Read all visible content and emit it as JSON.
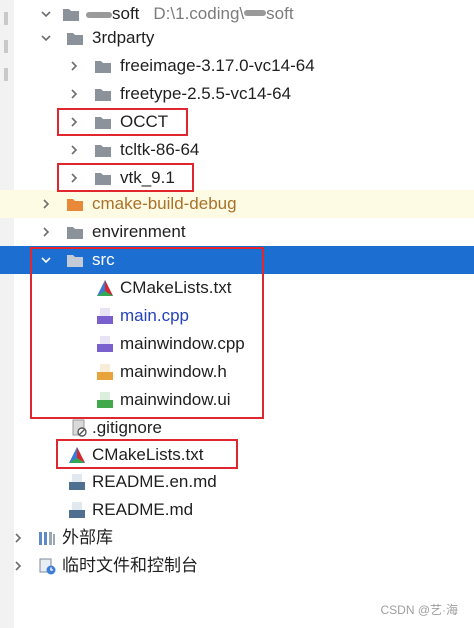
{
  "tree": {
    "root": {
      "label": "soft",
      "path": "D:\\1.coding\\",
      "path_tail": "soft"
    },
    "thirdparty": {
      "label": "3rdparty"
    },
    "freeimage": {
      "label": "freeimage-3.17.0-vc14-64"
    },
    "freetype": {
      "label": "freetype-2.5.5-vc14-64"
    },
    "occt": {
      "label": "OCCT"
    },
    "tcltk": {
      "label": "tcltk-86-64"
    },
    "vtk": {
      "label": "vtk_9.1"
    },
    "cmake_build": {
      "label": "cmake-build-debug"
    },
    "envirenment": {
      "label": "envirenment"
    },
    "src": {
      "label": "src"
    },
    "src_cmakelists": {
      "label": "CMakeLists.txt"
    },
    "main_cpp": {
      "label": "main.cpp"
    },
    "mainwindow_cpp": {
      "label": "mainwindow.cpp"
    },
    "mainwindow_h": {
      "label": "mainwindow.h"
    },
    "mainwindow_ui": {
      "label": "mainwindow.ui"
    },
    "gitignore": {
      "label": ".gitignore"
    },
    "root_cmakelists": {
      "label": "CMakeLists.txt"
    },
    "readme_en": {
      "label": "README.en.md"
    },
    "readme": {
      "label": "README.md"
    },
    "external_libs": {
      "label": "外部库"
    },
    "scratches": {
      "label": "临时文件和控制台"
    }
  },
  "icons": {
    "folder": "folder-icon",
    "cmake": "cmake-icon",
    "cpp": "cpp-file-icon",
    "header": "header-file-icon",
    "qt": "qt-ui-file-icon",
    "markdown": "markdown-file-icon",
    "gitignore": "gitignore-file-icon",
    "libraries": "library-icon",
    "scratches": "scratches-icon"
  },
  "badges": {
    "cpp": "C++",
    "header": "H",
    "qt": "Qt",
    "md": "MD"
  },
  "colors": {
    "selection": "#1c6fd0",
    "excluded_highlight": "#fdfbe4",
    "excluded_folder": "#e8893a",
    "annotation_box": "#e0262f",
    "link_text": "#2444b8"
  },
  "watermark": "CSDN @艺·海"
}
